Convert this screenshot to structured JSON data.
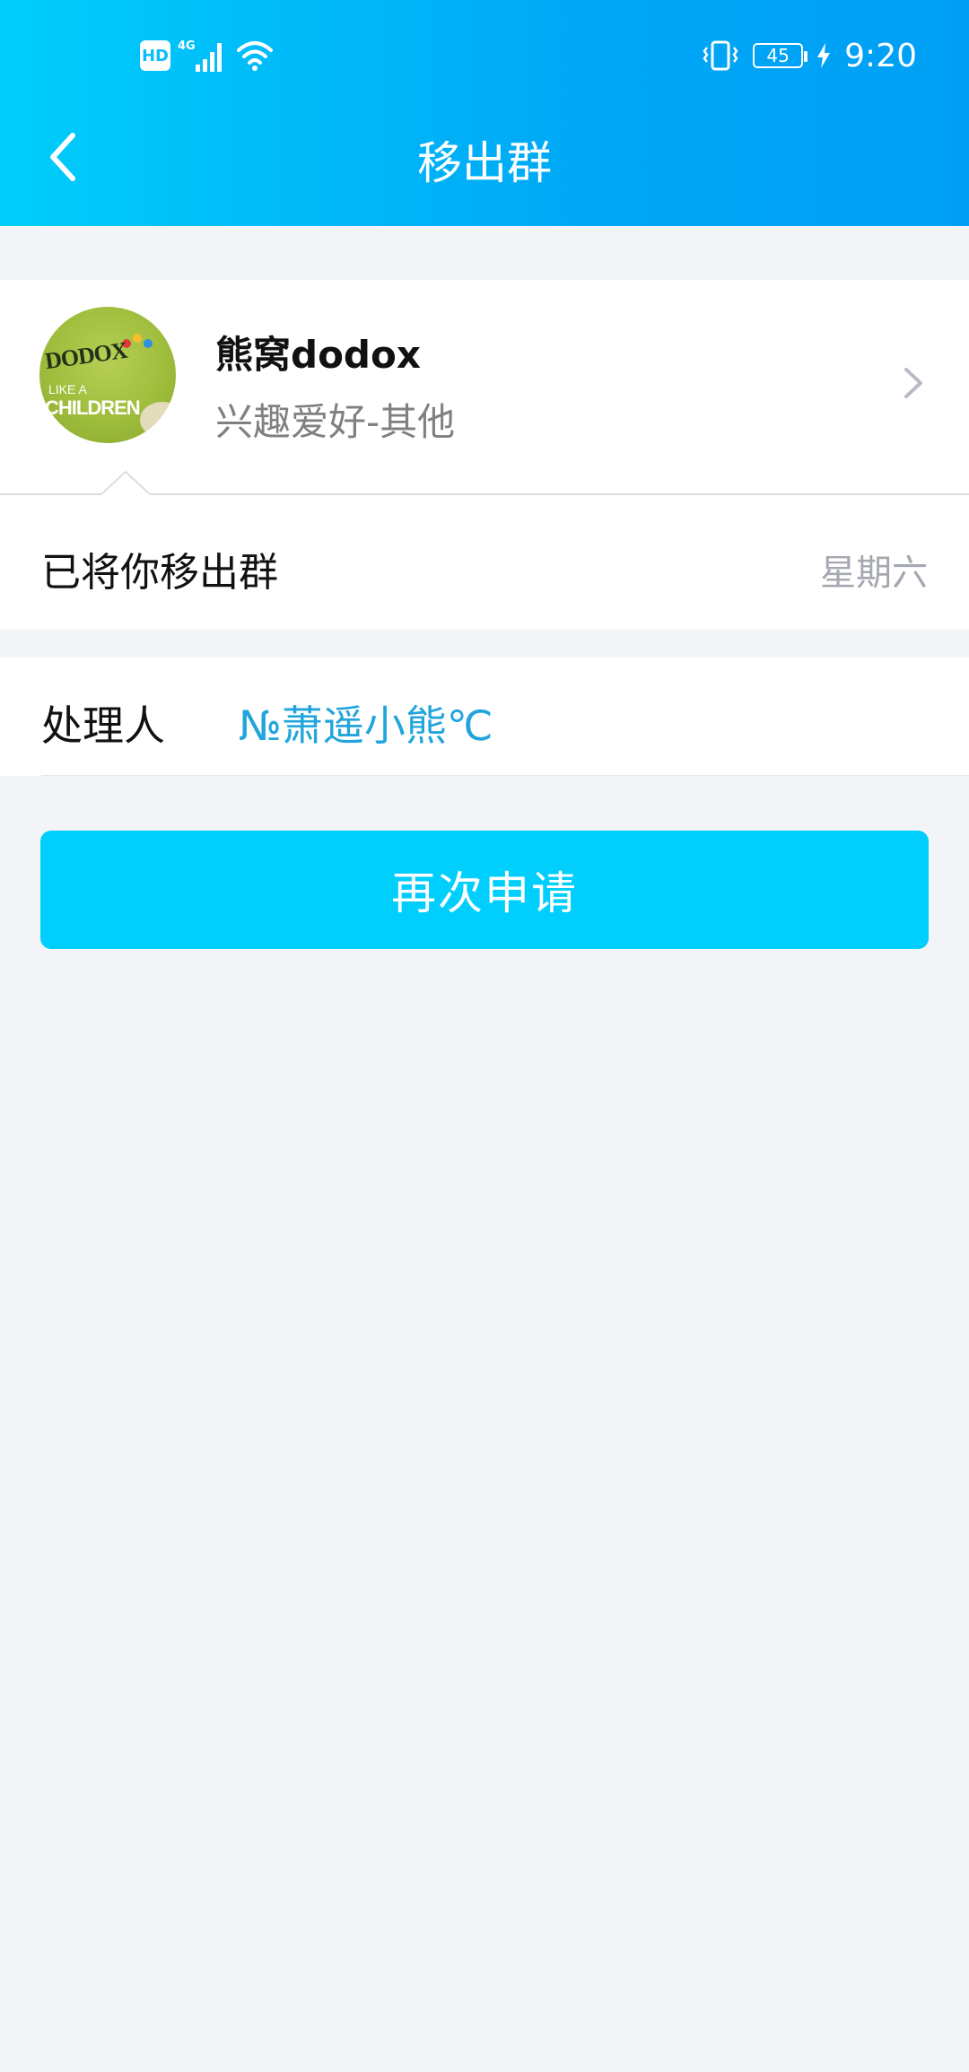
{
  "status_bar": {
    "hd_badge": "HD",
    "network": "4G",
    "battery": "45",
    "time": "9:20"
  },
  "header": {
    "title": "移出群",
    "back_icon": "chevron-left-icon"
  },
  "group": {
    "name": "熊窝dodox",
    "category": "兴趣爱好-其他",
    "avatar_text_1": "DODOX",
    "avatar_text_2": "LIKE A",
    "avatar_text_3": "CHILDREN"
  },
  "notice": {
    "text": "已将你移出群",
    "time": "星期六"
  },
  "handler": {
    "label": "处理人",
    "name": "№萧遥小熊℃"
  },
  "actions": {
    "reapply_label": "再次申请"
  },
  "colors": {
    "header_start": "#00cdfb",
    "header_end": "#009ff5",
    "button": "#00cefc",
    "link": "#21a5dc",
    "background": "#f2f4f8"
  }
}
